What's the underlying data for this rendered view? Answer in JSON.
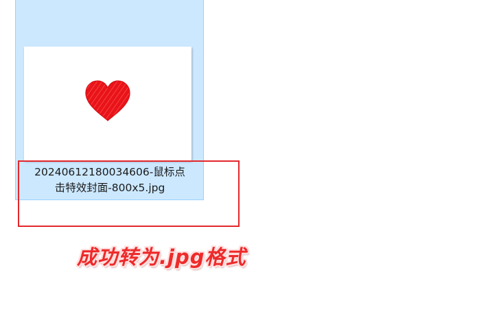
{
  "file": {
    "name_line1": "20240612180034606-鼠标点",
    "name_line2": "击特效封面-800x5.jpg",
    "thumbnail_icon": "heart-icon"
  },
  "annotation": {
    "caption": "成功转为.jpg格式"
  },
  "colors": {
    "selection_bg": "#cce8ff",
    "selection_border": "#99d1ff",
    "highlight_border": "#e3262b",
    "caption_text": "#ee2a2a",
    "heart": "#e8141a"
  }
}
